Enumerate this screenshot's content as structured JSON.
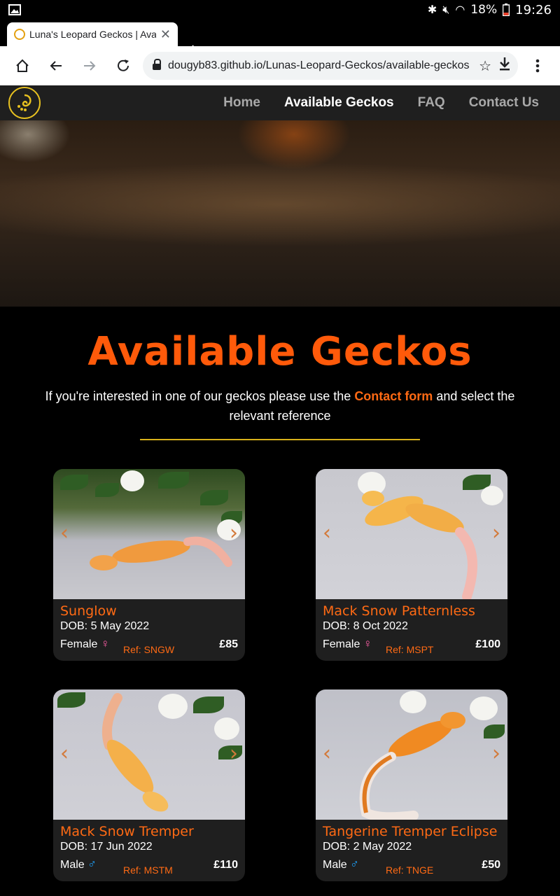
{
  "status_bar": {
    "battery": "18%",
    "time": "19:26"
  },
  "browser": {
    "tab_title": "Luna's Leopard Geckos | Available Geckos",
    "url": "dougyb83.github.io/Lunas-Leopard-Geckos/available-geckos"
  },
  "nav": {
    "links": [
      "Home",
      "Available Geckos",
      "FAQ",
      "Contact Us"
    ],
    "active": "Available Geckos"
  },
  "page": {
    "title": "Available Geckos",
    "intro_before": "If you're interested in one of our geckos please use the ",
    "intro_link": "Contact form",
    "intro_after": " and select the relevant reference"
  },
  "geckos": [
    {
      "name": "Sunglow",
      "dob": "DOB: 5 May 2022",
      "sex": "Female",
      "ref": "Ref: SNGW",
      "price": "£85"
    },
    {
      "name": "Mack Snow Patternless",
      "dob": "DOB: 8 Oct 2022",
      "sex": "Female",
      "ref": "Ref: MSPT",
      "price": "£100"
    },
    {
      "name": "Mack Snow Tremper",
      "dob": "DOB: 17 Jun 2022",
      "sex": "Male",
      "ref": "Ref: MSTM",
      "price": "£110"
    },
    {
      "name": "Tangerine Tremper Eclipse",
      "dob": "DOB: 2 May 2022",
      "sex": "Male",
      "ref": "Ref: TNGE",
      "price": "£50"
    }
  ],
  "icons": {
    "female": "♀",
    "male": "♂",
    "prev": "‹",
    "next": "›"
  },
  "colors": {
    "accent": "#ff5a0a",
    "divider": "#d9b21b",
    "female": "#ff5fa8",
    "male": "#1ea4ff"
  }
}
